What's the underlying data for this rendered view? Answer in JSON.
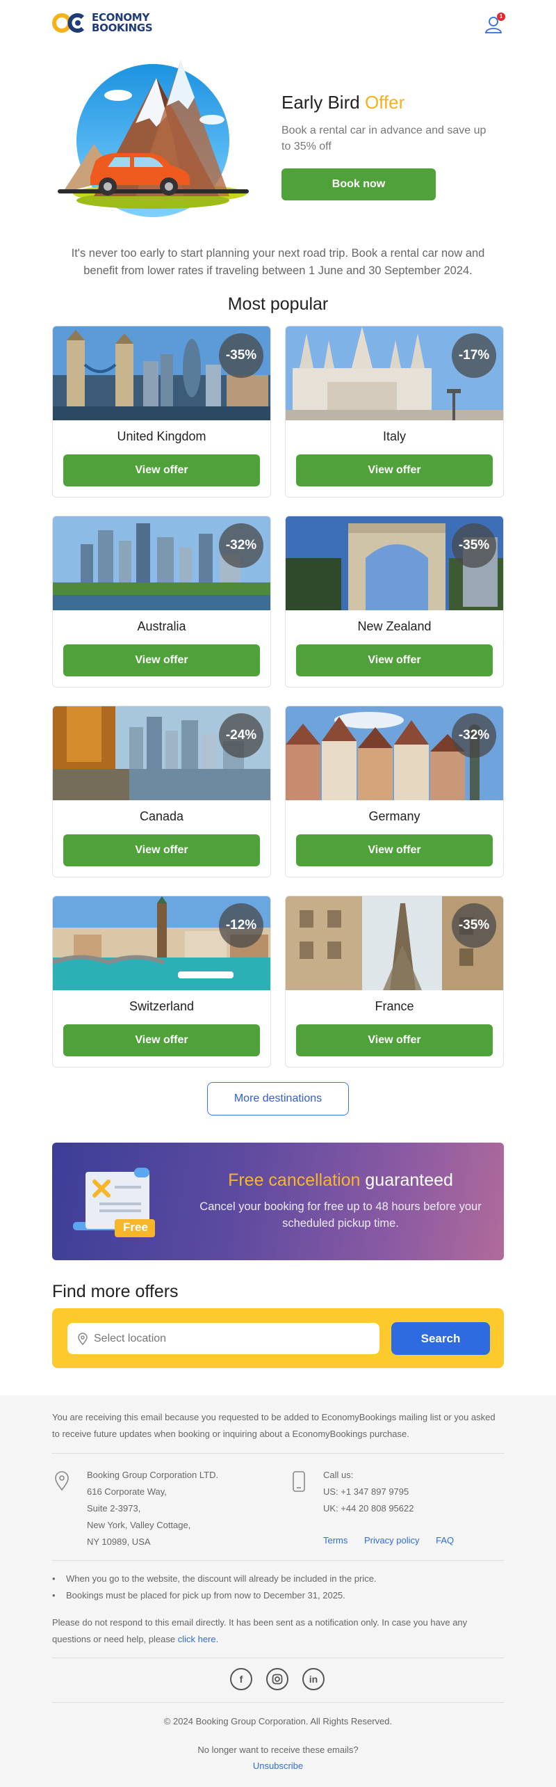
{
  "header": {
    "logo_line1": "ECONOMY",
    "logo_line2": "BOOKINGS",
    "notification_count": "1",
    "colors": {
      "brand_blue": "#1f3b78",
      "logo_yellow": "#f5b11b"
    }
  },
  "hero": {
    "title_main": "Early Bird",
    "title_accent": "Offer",
    "subtitle": "Book a rental car in advance and save up to 35% off",
    "cta_label": "Book now",
    "illustration": "car-mountain-illustration"
  },
  "intro": "It's never too early to start planning your next road trip. Book a rental car now and benefit from lower rates if traveling between 1 June and 30 September 2024.",
  "most_popular": {
    "title": "Most popular",
    "cards": [
      {
        "country": "United Kingdom",
        "discount": "-35%",
        "button": "View offer"
      },
      {
        "country": "Italy",
        "discount": "-17%",
        "button": "View offer"
      },
      {
        "country": "Australia",
        "discount": "-32%",
        "button": "View offer"
      },
      {
        "country": "New Zealand",
        "discount": "-35%",
        "button": "View offer"
      },
      {
        "country": "Canada",
        "discount": "-24%",
        "button": "View offer"
      },
      {
        "country": "Germany",
        "discount": "-32%",
        "button": "View offer"
      },
      {
        "country": "Switzerland",
        "discount": "-12%",
        "button": "View offer"
      },
      {
        "country": "France",
        "discount": "-35%",
        "button": "View offer"
      }
    ],
    "more_label": "More destinations"
  },
  "cancellation": {
    "title_accent": "Free cancellation",
    "title_rest": "guaranteed",
    "text": "Cancel your booking for free up to 48 hours before your scheduled pickup time.",
    "ribbon": "Free"
  },
  "find_offers": {
    "title": "Find more offers",
    "placeholder": "Select location",
    "search_label": "Search"
  },
  "footer": {
    "notice": "You are receiving this email because you requested to be added to EconomyBookings mailing list or you asked to receive future updates when booking or inquiring about a EconomyBookings purchase.",
    "address": [
      "Booking Group Corporation LTD.",
      "616 Corporate Way,",
      "Suite 2-3973,",
      "New York, Valley Cottage,",
      "NY 10989, USA"
    ],
    "call_label": "Call us:",
    "phone_us": "US: +1 347 897 9795",
    "phone_uk": "UK: +44 20 808 95622",
    "links": [
      "Terms",
      "Privacy policy",
      "FAQ"
    ],
    "bullets": [
      "When you go to the website, the discount will already be included in the price.",
      "Bookings must be placed for pick up from now to December 31, 2025."
    ],
    "reply_text": "Please do not respond to this email directly. It has been sent as a notification only. In case you have any questions or need help, please",
    "reply_link": "click here.",
    "copyright": "© 2024 Booking Group Corporation. All Rights Reserved.",
    "unsub_question": "No longer want to receive these emails?",
    "unsub_link": "Unsubscribe"
  }
}
